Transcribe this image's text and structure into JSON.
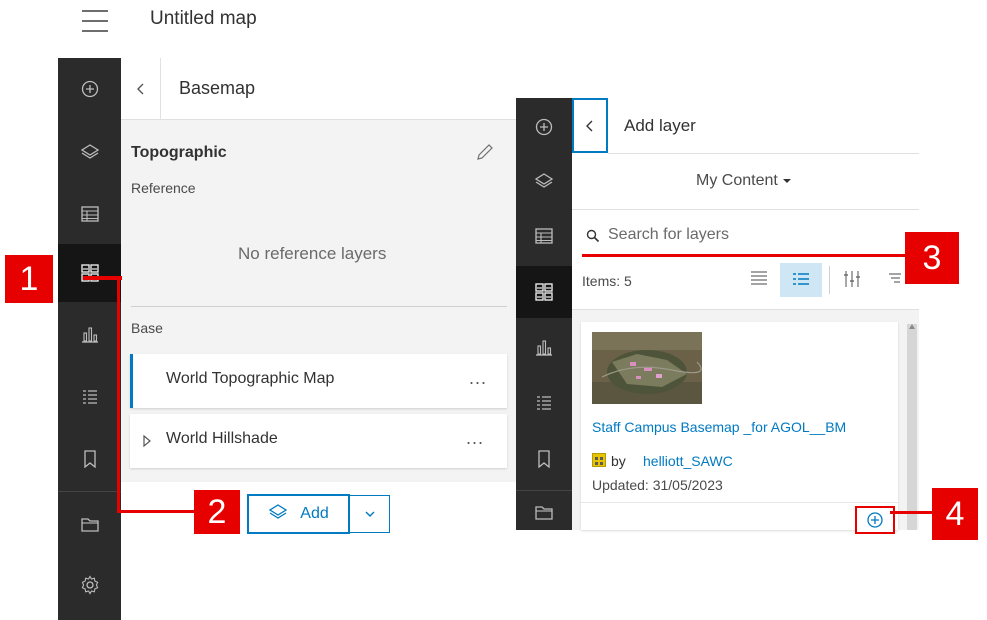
{
  "header": {
    "map_title": "Untitled map",
    "menu_icon": "hamburger-icon"
  },
  "basemap_panel": {
    "title": "Basemap",
    "basemap_name": "Topographic",
    "reference_label": "Reference",
    "no_reference_text": "No reference layers",
    "base_label": "Base",
    "base_layers": [
      {
        "label": "World Topographic Map",
        "more": "..."
      },
      {
        "label": "World Hillshade",
        "more": "..."
      }
    ],
    "add_label": "Add"
  },
  "add_layer_panel": {
    "title": "Add layer",
    "source_select": "My Content",
    "search_placeholder": "Search for layers",
    "items_count": "Items: 5",
    "item": {
      "title": "Staff Campus Basemap _for AGOL__BM",
      "by": "by",
      "owner": "helliott_SAWC",
      "updated": "Updated: 31/05/2023"
    }
  },
  "callouts": [
    "1",
    "2",
    "3",
    "4"
  ],
  "colors": {
    "rail": "#2b2b2b",
    "rail_active": "#151515",
    "accent": "#007ac2",
    "callout": "#e60000",
    "panel_bg": "#f3f3f3"
  }
}
